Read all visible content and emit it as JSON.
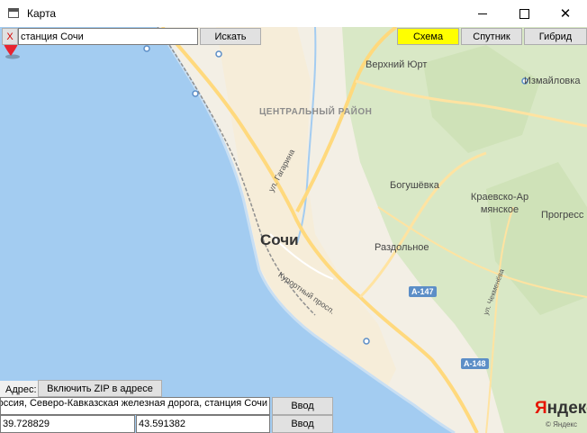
{
  "window": {
    "title": "Карта"
  },
  "toolbar": {
    "clear_label": "X",
    "search_value": "станция Сочи",
    "search_label": "Искать",
    "map_types": [
      {
        "label": "Схема",
        "active": true
      },
      {
        "label": "Спутник",
        "active": false
      },
      {
        "label": "Гибрид",
        "active": false
      }
    ],
    "active_color": "#ffff00"
  },
  "map": {
    "district": "ЦЕНТРАЛЬНЫЙ РАЙОН",
    "city": "Сочи",
    "places": [
      "Верхний Юрт",
      "Измайловка",
      "Богушёвка",
      "Краевско-Армянское",
      "Прогресс",
      "Раздольное"
    ],
    "streets": [
      "ул. Гагарина",
      "Курортный просп.",
      "ул. Чекменёва"
    ],
    "roads": [
      "А-147",
      "А-148"
    ],
    "logo": "Яндекс",
    "copyright": "© Яндекс",
    "colors": {
      "sea": "#a3ccf1",
      "land": "#f3efe5",
      "forest": "#d9e8c6",
      "road": "#ffd97d",
      "pin": "#e8232f"
    }
  },
  "form": {
    "address_label": "Адрес:",
    "zip_button": "Включить ZIP в адресе",
    "address_value": "Россия, Северо-Кавказская железная дорога, станция Сочи",
    "enter_label": "Ввод",
    "latitude": "39.728829",
    "longitude": "43.591382"
  }
}
